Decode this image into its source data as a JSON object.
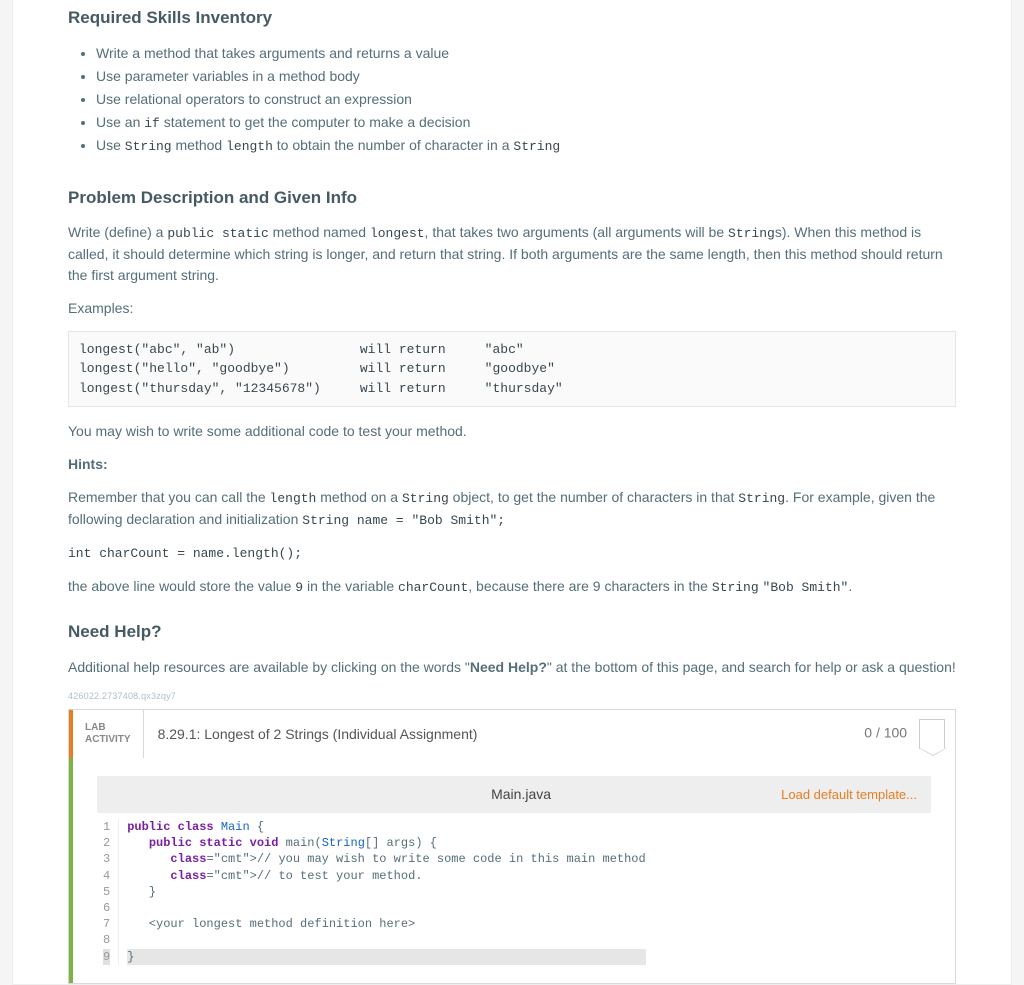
{
  "skills": {
    "heading": "Required Skills Inventory",
    "items": [
      "Write a method that takes arguments and returns a value",
      "Use parameter variables in a method body",
      "Use relational operators to construct an expression",
      "Use an |if| statement to get the computer to make a decision",
      "Use |String| method |length| to obtain the number of character in a |String|"
    ]
  },
  "problem": {
    "heading": "Problem Description and Given Info",
    "intro_before": "Write (define) a ",
    "code1": "public static",
    "intro_mid1": " method named ",
    "code2": "longest",
    "intro_mid2": ", that takes two arguments (all arguments will be ",
    "code3": "String",
    "intro_after": "s). When this method is called, it should determine which string is longer, and return that string. If both arguments are the same length, then this method should return the first argument string.",
    "examples_label": "Examples:",
    "examples_block": "longest(\"abc\", \"ab\")                will return     \"abc\"\nlongest(\"hello\", \"goodbye\")         will return     \"goodbye\"\nlongest(\"thursday\", \"12345678\")     will return     \"thursday\"",
    "followup": "You may wish to write some additional code to test your method.",
    "hints_label": "Hints:",
    "hint_p1_a": "Remember that you can call the ",
    "hint_code1": "length",
    "hint_p1_b": " method on a ",
    "hint_code2": "String",
    "hint_p1_c": " object, to get the number of characters in that ",
    "hint_code3": "String",
    "hint_p1_d": ". For example, given the following declaration and initialization ",
    "hint_code4": "String name = \"Bob Smith\";",
    "hint_code_line": "int charCount = name.length();",
    "hint_p2_a": "the above line would store the value ",
    "hint_code5": "9",
    "hint_p2_b": " in the variable ",
    "hint_code6": "charCount",
    "hint_p2_c": ", because there are 9 characters in the ",
    "hint_code7": "String",
    "hint_p2_d": " ",
    "hint_code8": "\"Bob Smith\"",
    "hint_p2_e": "."
  },
  "help": {
    "heading": "Need Help?",
    "text_a": "Additional help resources are available by clicking on the words \"",
    "text_bold": "Need Help?",
    "text_b": "\" at the bottom of this page, and search for help or ask a question!"
  },
  "trace_id": "426022.2737408.qx3zqy7",
  "lab": {
    "tag_line1": "LAB",
    "tag_line2": "ACTIVITY",
    "title": "8.29.1: Longest of 2 Strings (Individual Assignment)",
    "score": "0 / 100",
    "file_name": "Main.java",
    "load_template": "Load default template...",
    "code_lines": [
      {
        "n": 1,
        "raw": "public class Main {"
      },
      {
        "n": 2,
        "raw": "   public static void main(String[] args) {"
      },
      {
        "n": 3,
        "raw": "      // you may wish to write some code in this main method"
      },
      {
        "n": 4,
        "raw": "      // to test your method."
      },
      {
        "n": 5,
        "raw": "   }"
      },
      {
        "n": 6,
        "raw": ""
      },
      {
        "n": 7,
        "raw": "   <your longest method definition here>"
      },
      {
        "n": 8,
        "raw": ""
      },
      {
        "n": 9,
        "raw": "}"
      }
    ]
  }
}
